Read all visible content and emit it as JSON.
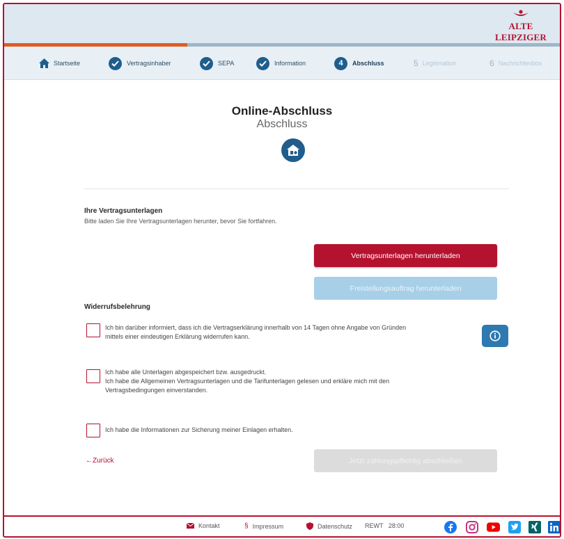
{
  "brand": {
    "name": "ALTE LEIPZIGER",
    "color": "#b5122f"
  },
  "progress": {
    "fraction": 0.33
  },
  "steps": [
    {
      "label": "Startseite",
      "icon": "home-icon",
      "state": "done"
    },
    {
      "label": "Vertragsinhaber",
      "icon": "check-circle-icon",
      "state": "done"
    },
    {
      "label": "SEPA",
      "icon": "check-circle-icon",
      "state": "done"
    },
    {
      "label": "Information",
      "icon": "check-circle-icon",
      "state": "done"
    },
    {
      "number": "4",
      "label": "Abschluss",
      "state": "active"
    },
    {
      "number": "5",
      "label": "Legitimation",
      "state": "pending"
    },
    {
      "number": "6",
      "label": "Nachrichtenbox",
      "state": "pending"
    }
  ],
  "page": {
    "title": "Online-Abschluss",
    "subtitle": "Abschluss",
    "icon": "document-house-icon"
  },
  "documents": {
    "heading": "Ihre Vertragsunterlagen",
    "text": "Bitte laden Sie Ihre Vertragsunterlagen herunter, bevor Sie fortfahren.",
    "download_button": "Vertragsunterlagen herunterladen",
    "exemption_button": "Freistellungsauftrag herunterladen"
  },
  "withdrawal": {
    "heading": "Widerrufsbelehrung",
    "checkbox1": [
      "Ich bin darüber informiert, dass ich die Vertragserklärung innerhalb von 14 Tagen ohne Angabe von Gründen",
      "mittels einer eindeutigen Erklärung widerrufen kann."
    ],
    "checkbox2": [
      "Ich habe alle Unterlagen abgespeichert bzw. ausgedruckt.",
      "Ich habe die Allgemeinen Vertragsunterlagen und die Tarifunterlagen gelesen und erkläre mich mit den",
      "Vertragsbedingungen einverstanden."
    ],
    "checkbox3": [
      "Ich habe die Informationen zur Sicherung meiner Einlagen erhalten."
    ],
    "info_icon": "info-icon"
  },
  "nav": {
    "back": "←Zurück",
    "submit": "Jetzt zahlungspflichtig abschließen"
  },
  "footer": {
    "contact": "Kontakt",
    "imprint": "Impressum",
    "privacy": "Datenschutz",
    "rewt": "REWT",
    "time": "28:00",
    "social": [
      "facebook-icon",
      "instagram-icon",
      "youtube-icon",
      "twitter-icon",
      "xing-icon",
      "linkedin-icon"
    ]
  }
}
